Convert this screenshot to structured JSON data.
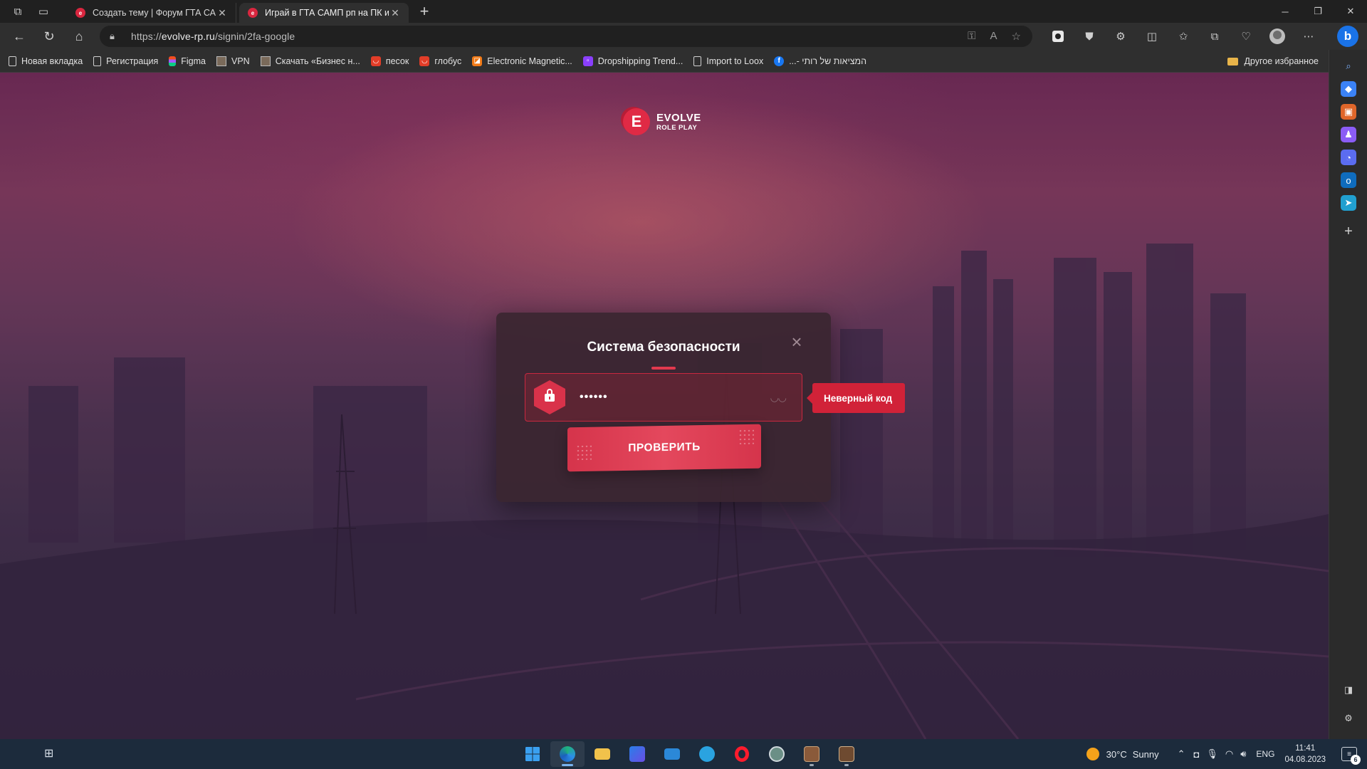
{
  "browser": {
    "tabs": [
      {
        "label": "Создать тему | Форум ГТА САМП",
        "active": false
      },
      {
        "label": "Играй в ГТА САМП рп на ПК и ан",
        "active": true
      }
    ],
    "url_prefix": "https://",
    "url_host": "evolve-rp.ru",
    "url_path": "/signin/2fa-google",
    "bookmarks": [
      {
        "label": "Новая вкладка",
        "icon": "page-icon"
      },
      {
        "label": "Регистрация",
        "icon": "page-icon"
      },
      {
        "label": "Figma",
        "icon": "figma-icon"
      },
      {
        "label": "VPN",
        "icon": "image-icon"
      },
      {
        "label": "Скачать «Бизнес н...",
        "icon": "image-icon"
      },
      {
        "label": "песок",
        "icon": "shop-icon"
      },
      {
        "label": "глобус",
        "icon": "shop-icon"
      },
      {
        "label": "Electronic Magnetic...",
        "icon": "orange-icon"
      },
      {
        "label": "Dropshipping Trend...",
        "icon": "twitch-icon"
      },
      {
        "label": "Import to Loox",
        "icon": "page-icon"
      },
      {
        "label": "...- המציאות של רותי",
        "icon": "facebook-icon"
      }
    ],
    "other_bookmarks": "Другое избранное"
  },
  "page": {
    "logo_line1": "EVOLVE",
    "logo_line2": "ROLE PLAY",
    "logo_letter": "E",
    "modal": {
      "title": "Система безопасности",
      "code_value": "••••••",
      "error": "Неверный код",
      "submit_label": "ПРОВЕРИТЬ"
    }
  },
  "taskbar": {
    "weather_temp": "30°C",
    "weather_text": "Sunny",
    "lang": "ENG",
    "time": "11:41",
    "date": "04.08.2023",
    "notifications": "6"
  },
  "colors": {
    "accent": "#d9324a",
    "error": "#d12238",
    "taskbar": "#1c2b3c"
  }
}
